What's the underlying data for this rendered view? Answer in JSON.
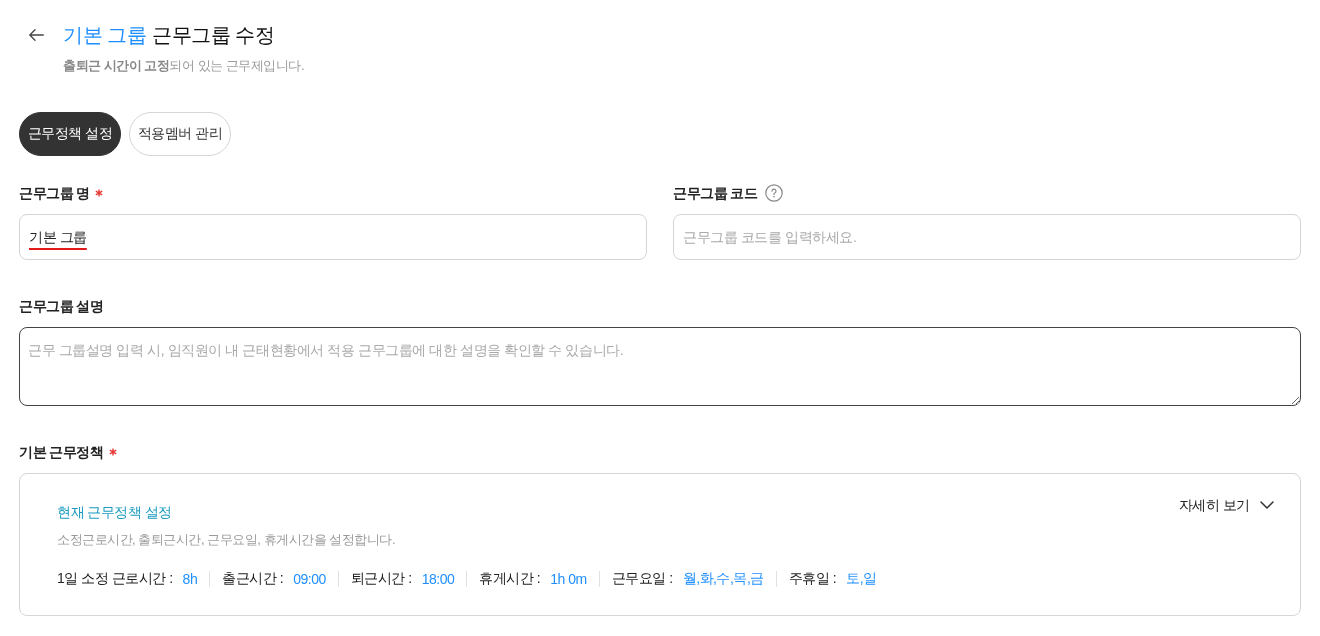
{
  "header": {
    "title_group": "기본 그룹",
    "title": "근무그룹 수정",
    "subtitle": "**출퇴근 시간이 고정**되어 있는 근무제입니다."
  },
  "tabs": [
    {
      "label": "근무정책 설정",
      "selected": true
    },
    {
      "label": "적용멤버 관리",
      "selected": false
    }
  ],
  "fields": [
    {
      "label": "근무그룹 명",
      "required": true,
      "help": false,
      "value": "기본 그룹",
      "spellcheck_flagged": true
    },
    {
      "label": "근무그룹 코드",
      "required": false,
      "help": true,
      "placeholder": "근무그룹 코드를 입력하세요.",
      "spellcheck_flagged": false
    }
  ],
  "description": {
    "label": "근무그룹 설명",
    "placeholder": "근무 그룹설명 입력 시, 임직원이 내 근태현황에서 적용 근무그룹에 대한 설명을 확인할 수 있습니다.",
    "focused": true
  },
  "policy": {
    "label": "기본 근무정책",
    "required": true,
    "card": {
      "title": "현재 근무정책 설정",
      "description": "소정근로시간, 출퇴근시간, 근무요일, 휴게시간을 설정합니다.",
      "toggle": {
        "label": "자세히 보기",
        "expanded": false
      },
      "items": [
        {
          "label": "1일 소정 근로시간 :",
          "value": "8h"
        },
        {
          "label": "출근시간 :",
          "value": "09:00"
        },
        {
          "label": "퇴근시간 :",
          "value": "18:00"
        },
        {
          "label": "휴게시간 :",
          "value": "1h 0m"
        },
        {
          "label": "근무요일 :",
          "value": "월,화,수,목,금"
        },
        {
          "label": "주휴일 :",
          "value": "토,일"
        }
      ]
    }
  }
}
